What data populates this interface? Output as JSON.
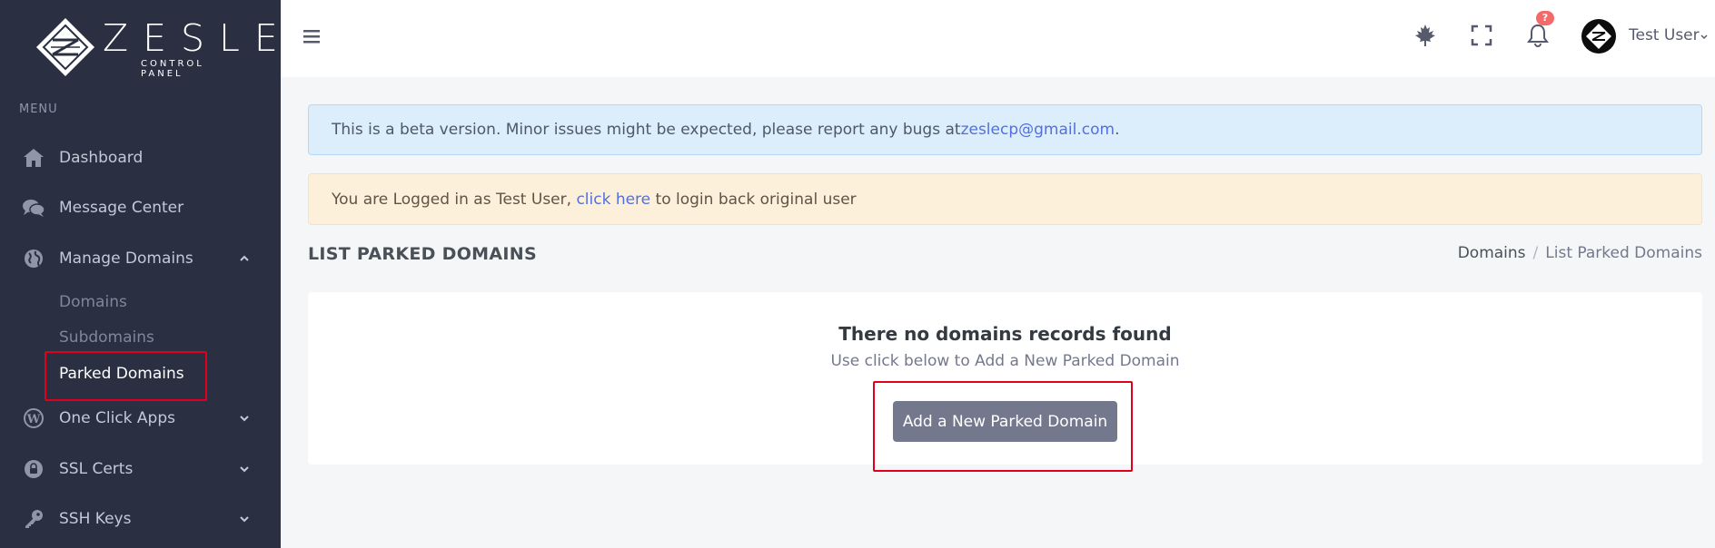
{
  "brand": {
    "name": "ZESLE",
    "subtitle": "CONTROL PANEL"
  },
  "sidebar": {
    "menu_title": "MENU",
    "items": [
      {
        "label": "Dashboard",
        "icon": "home-icon"
      },
      {
        "label": "Message Center",
        "icon": "chat-icon"
      },
      {
        "label": "Manage Domains",
        "icon": "globe-icon",
        "expanded": true
      },
      {
        "label": "One Click Apps",
        "icon": "wordpress-icon"
      },
      {
        "label": "SSL Certs",
        "icon": "lock-icon"
      },
      {
        "label": "SSH Keys",
        "icon": "key-icon"
      }
    ],
    "sub_items": [
      {
        "label": "Domains"
      },
      {
        "label": "Subdomains"
      },
      {
        "label": "Parked Domains",
        "active": true
      }
    ]
  },
  "topbar": {
    "notification_count": "?",
    "user_name": "Test User"
  },
  "alerts": {
    "beta_text": "This is a beta version. Minor issues might be expected, please report any bugs at ",
    "beta_email": "zeslecp@gmail.com",
    "beta_end": ".",
    "login_text": "You are Logged in as Test User, ",
    "login_link": "click here",
    "login_end": " to login back original user"
  },
  "page": {
    "title": "LIST PARKED DOMAINS",
    "breadcrumb": [
      "Domains",
      "List Parked Domains"
    ],
    "breadcrumb_sep": "/"
  },
  "card": {
    "title": "There no domains records found",
    "subtitle": "Use click below to Add a New Parked Domain",
    "button_label": "Add a New Parked Domain"
  },
  "colors": {
    "sidebar_bg": "#2a3042",
    "highlight": "#e0001b",
    "button_bg": "#74788d",
    "link": "#5570d9"
  }
}
